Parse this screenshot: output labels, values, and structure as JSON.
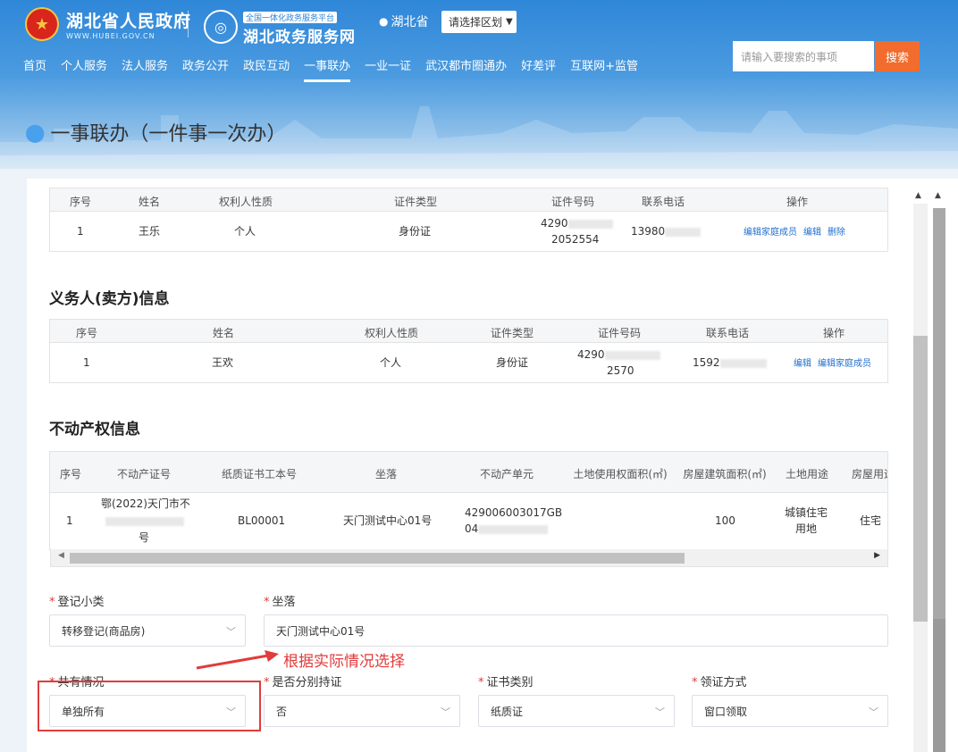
{
  "header": {
    "gov_name": "湖北省人民政府",
    "gov_url": "WWW.HUBEI.GOV.CN",
    "platform_tag": "全国一体化政务服务平台",
    "platform_name": "湖北政务服务网",
    "region": "湖北省",
    "region_select": "请选择区划",
    "search_placeholder": "请输入要搜索的事项",
    "search_button": "搜索",
    "nav": [
      "首页",
      "个人服务",
      "法人服务",
      "政务公开",
      "政民互动",
      "一事联办",
      "一业一证",
      "武汉都市圈通办",
      "好差评",
      "互联网+监管"
    ],
    "active_nav": "一事联办",
    "page_title": "一事联办（一件事一次办）"
  },
  "rights_holder_table": {
    "headers": [
      "序号",
      "姓名",
      "权利人性质",
      "证件类型",
      "证件号码",
      "联系电话",
      "操作"
    ],
    "row": {
      "index": "1",
      "name": "王乐",
      "nature": "个人",
      "id_type": "身份证",
      "id_no_1": "4290",
      "id_no_2": "2052554",
      "phone": "13980",
      "actions": [
        "编辑家庭成员",
        "编辑",
        "删除"
      ]
    }
  },
  "obligor_section": {
    "title": "义务人(卖方)信息",
    "headers": [
      "序号",
      "姓名",
      "权利人性质",
      "证件类型",
      "证件号码",
      "联系电话",
      "操作"
    ],
    "row": {
      "index": "1",
      "name": "王欢",
      "nature": "个人",
      "id_type": "身份证",
      "id_no_1": "4290",
      "id_no_2": "2570",
      "phone": "1592",
      "actions": [
        "编辑",
        "编辑家庭成员"
      ]
    }
  },
  "property_section": {
    "title": "不动产权信息",
    "headers": [
      "序号",
      "不动产证号",
      "纸质证书工本号",
      "坐落",
      "不动产单元",
      "土地使用权面积(㎡)",
      "房屋建筑面积(㎡)",
      "土地用途",
      "房屋用途"
    ],
    "row": {
      "index": "1",
      "cert_no_1": "鄂(2022)天门市不",
      "cert_no_2": "号",
      "paper_no": "BL00001",
      "location": "天门测试中心01号",
      "unit_1": "429006003017GB",
      "unit_2": "04",
      "land_area": "",
      "building_area": "100",
      "land_use_1": "城镇住宅",
      "land_use_2": "用地",
      "house_use": "住宅"
    }
  },
  "form": {
    "reg_subtype_label": "登记小类",
    "reg_subtype_value": "转移登记(商品房)",
    "location_label": "坐落",
    "location_value": "天门测试中心01号",
    "ownership_label": "共有情况",
    "ownership_value": "单独所有",
    "separate_cert_label": "是否分别持证",
    "separate_cert_value": "否",
    "cert_type_label": "证书类别",
    "cert_type_value": "纸质证",
    "pickup_label": "领证方式",
    "pickup_value": "窗口领取"
  },
  "annotation": "根据实际情况选择",
  "colors": {
    "primary": "#2f87d8",
    "search_btn": "#f26c2d",
    "required": "#e03b3b",
    "annotation": "#e23b3b",
    "link": "#1f6fce"
  }
}
